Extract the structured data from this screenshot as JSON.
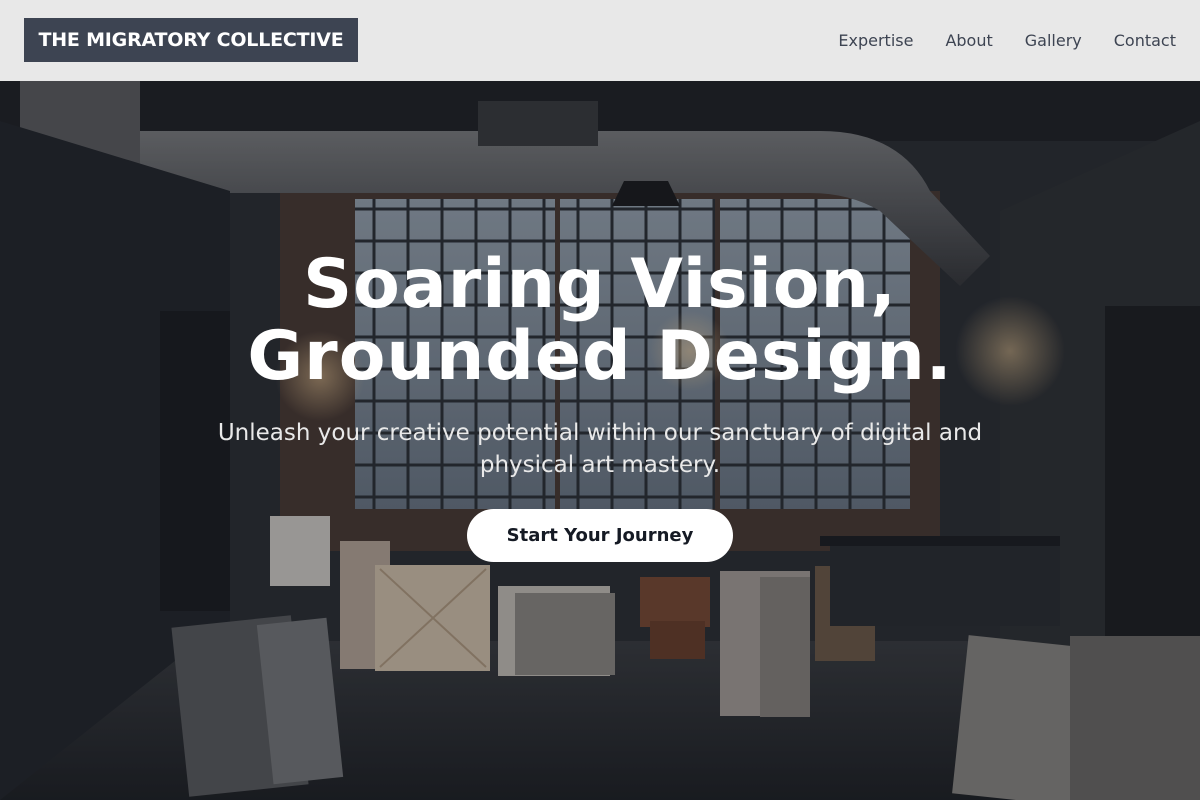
{
  "header": {
    "brand": "THE MIGRATORY COLLECTIVE",
    "nav": [
      {
        "label": "Expertise"
      },
      {
        "label": "About"
      },
      {
        "label": "Gallery"
      },
      {
        "label": "Contact"
      }
    ]
  },
  "hero": {
    "headline_line1": "Soaring Vision,",
    "headline_line2": "Grounded Design.",
    "subtitle": "Unleash your creative potential within our sanctuary of digital and physical art mastery.",
    "cta_label": "Start Your Journey"
  },
  "colors": {
    "header_bg": "#e8e8e8",
    "brand_bg": "#3d4452",
    "nav_text": "#3d4452",
    "cta_bg": "#ffffff",
    "cta_text": "#151a24"
  }
}
